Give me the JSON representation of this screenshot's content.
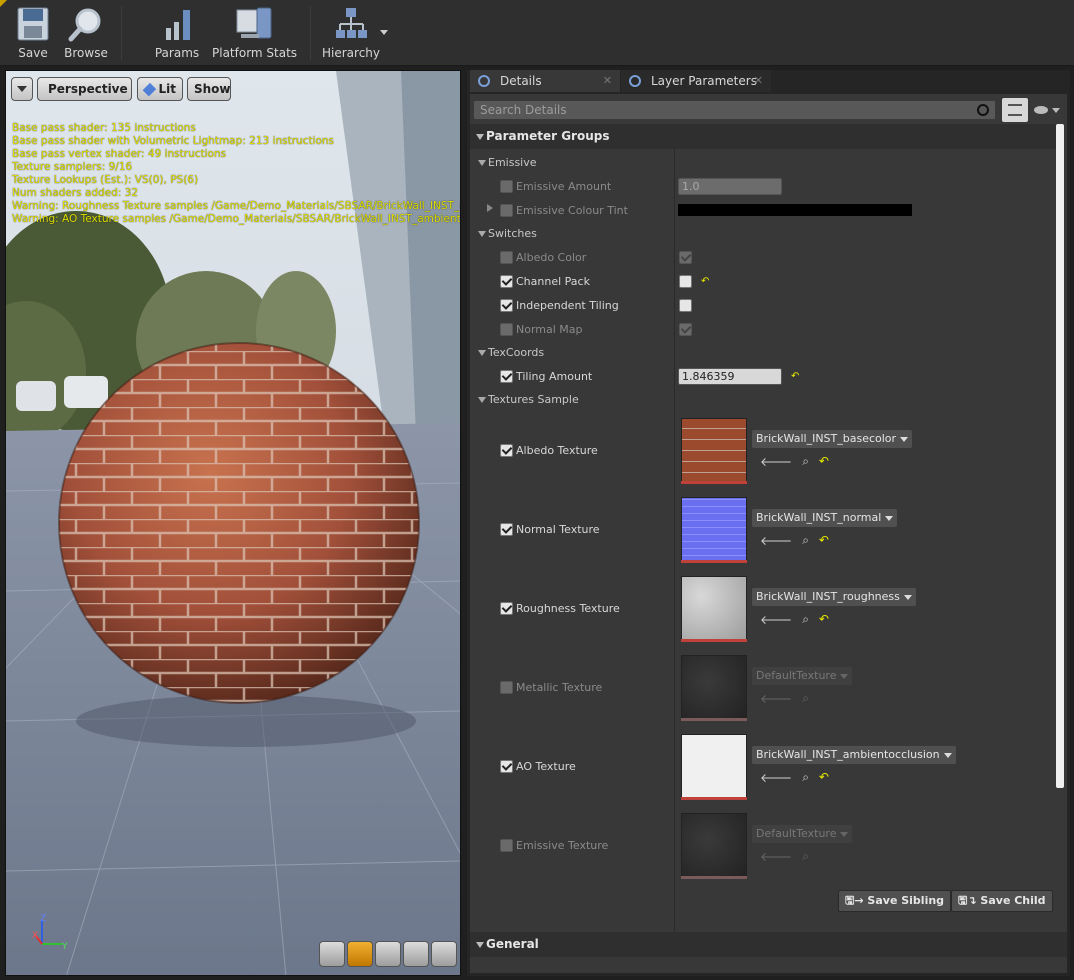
{
  "toolbar": {
    "save": "Save",
    "browse": "Browse",
    "params": "Params",
    "platform_stats": "Platform Stats",
    "hierarchy": "Hierarchy"
  },
  "viewport": {
    "perspective": "Perspective",
    "lit": "Lit",
    "show": "Show",
    "stats": [
      "Base pass shader: 135 instructions",
      "Base pass shader with Volumetric Lightmap: 213 instructions",
      "Base pass vertex shader: 49 instructions",
      "Texture samplers: 9/16",
      "Texture Lookups (Est.): VS(0), PS(6)",
      "Num shaders added: 32",
      "Warning: Roughness Texture samples /Game/Demo_Materials/SBSAR/BrickWall_INST_rou",
      "Warning: AO Texture samples /Game/Demo_Materials/SBSAR/BrickWall_INST_ambientocc"
    ]
  },
  "tabs": {
    "details": "Details",
    "layer_parameters": "Layer Parameters"
  },
  "search": {
    "placeholder": "Search Details"
  },
  "parameter_groups": "Parameter Groups",
  "groups": {
    "emissive": "Emissive",
    "emissive_amount": "Emissive Amount",
    "emissive_amount_value": "1.0",
    "emissive_colour_tint": "Emissive Colour Tint",
    "switches": "Switches",
    "albedo_color": "Albedo Color",
    "channel_pack": "Channel Pack",
    "independent_tiling": "Independent Tiling",
    "normal_map": "Normal Map",
    "texcoords": "TexCoords",
    "tiling_amount": "Tiling Amount",
    "tiling_amount_value": "1.846359",
    "textures_sample": "Textures Sample",
    "albedo_texture": "Albedo Texture",
    "albedo_asset": "BrickWall_INST_basecolor",
    "normal_texture": "Normal Texture",
    "normal_asset": "BrickWall_INST_normal",
    "roughness_texture": "Roughness Texture",
    "roughness_asset": "BrickWall_INST_roughness",
    "metallic_texture": "Metallic Texture",
    "metallic_asset": "DefaultTexture",
    "ao_texture": "AO Texture",
    "ao_asset": "BrickWall_INST_ambientocclusion",
    "emissive_texture": "Emissive Texture",
    "emissive_asset": "DefaultTexture"
  },
  "buttons": {
    "save_sibling": "Save Sibling",
    "save_child": "Save Child"
  },
  "general": "General",
  "colors": {
    "accent": "#e8e800",
    "panel": "#383838",
    "toolbar": "#2f2f2f"
  }
}
